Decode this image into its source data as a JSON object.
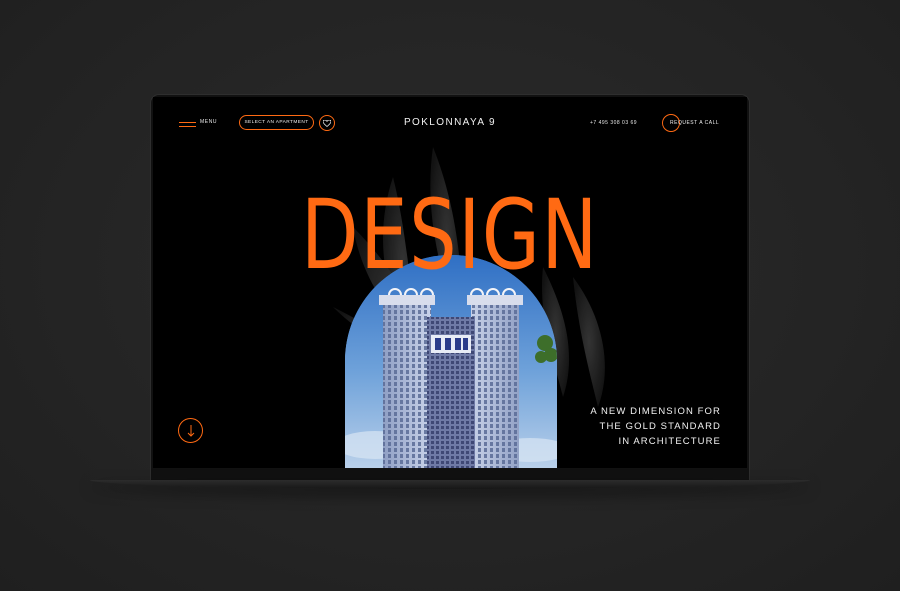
{
  "nav": {
    "menu_label": "MENU",
    "select_label": "SELECT AN APARTMENT",
    "brand": "POKLONNAYA 9",
    "phone": "+7 495 308 03 69",
    "call_label": "REQUEST A CALL",
    "favorite_icon": "heart-icon",
    "menu_icon": "hamburger-icon"
  },
  "hero": {
    "headline": "DESIGN",
    "tagline": [
      "A NEW DIMENSION FOR",
      "THE GOLD STANDARD",
      "IN ARCHITECTURE"
    ],
    "scroll_icon": "arrow-down-icon"
  },
  "colors": {
    "accent": "#ff6a13",
    "background": "#000000",
    "page_bg": "#252525",
    "text": "#f2f2f2"
  }
}
